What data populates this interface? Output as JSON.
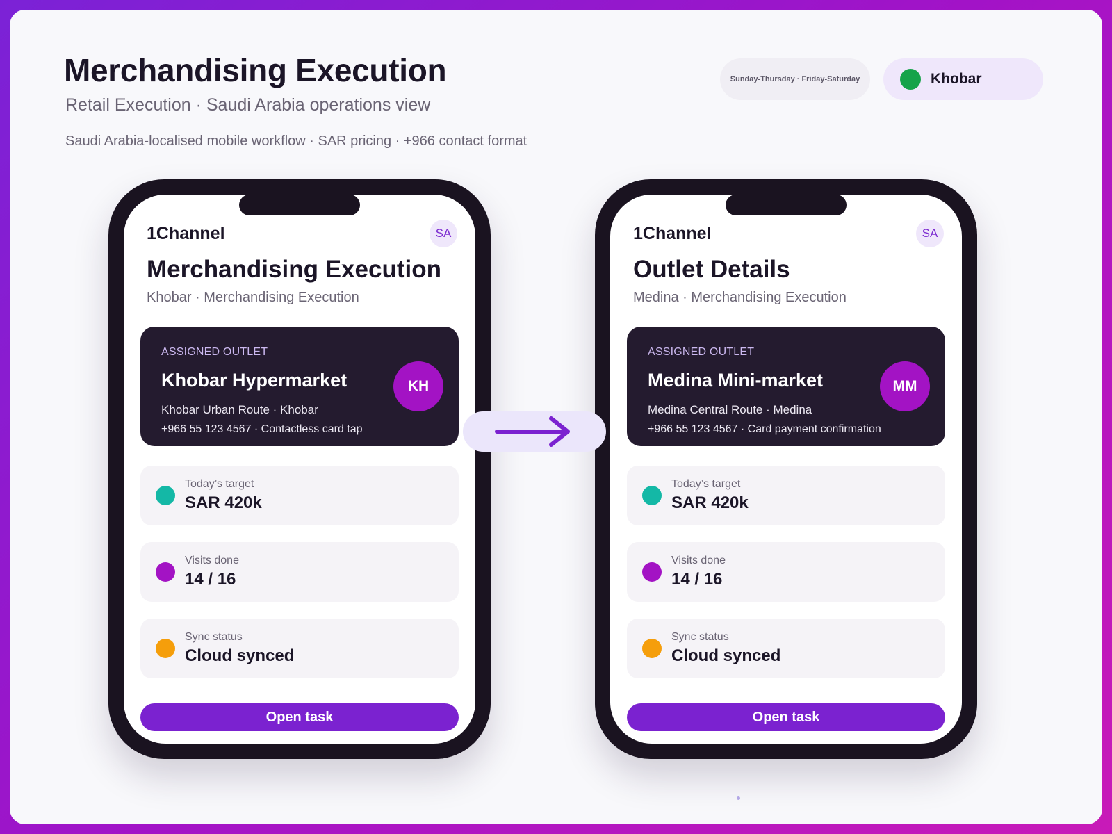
{
  "header": {
    "title": "Merchandising Execution",
    "subtitle": "Retail Execution · Saudi Arabia operations view",
    "meta": "Saudi Arabia-localised mobile workflow · SAR pricing · +966 contact format",
    "schedule": "Sunday-Thursday · Friday-Saturday",
    "city": "Khobar",
    "city_status_color": "#16a34a"
  },
  "colors": {
    "accent": "#7b22d0",
    "card_dark": "#241b2f",
    "avatar": "#a313c4",
    "target_dot": "#14b8a6",
    "visits_dot": "#a313c4",
    "sync_dot": "#f59e0b"
  },
  "phones": [
    {
      "brand": "1Channel",
      "lang": "SA",
      "title": "Merchandising Execution",
      "subtitle": "Khobar · Merchandising Execution",
      "outlet": {
        "kicker": "ASSIGNED OUTLET",
        "name": "Khobar Hypermarket",
        "route": "Khobar Urban Route · Khobar",
        "contact": "+966 55 123 4567 · Contactless card tap",
        "initials": "KH"
      },
      "stats": [
        {
          "label": "Today’s target",
          "value": "SAR 420k"
        },
        {
          "label": "Visits done",
          "value": "14 / 16"
        },
        {
          "label": "Sync status",
          "value": "Cloud synced"
        }
      ],
      "button": "Open task"
    },
    {
      "brand": "1Channel",
      "lang": "SA",
      "title": "Outlet Details",
      "subtitle": "Medina · Merchandising Execution",
      "outlet": {
        "kicker": "ASSIGNED OUTLET",
        "name": "Medina Mini-market",
        "route": "Medina Central Route · Medina",
        "contact": "+966 55 123 4567 · Card payment confirmation",
        "initials": "MM"
      },
      "stats": [
        {
          "label": "Today’s target",
          "value": "SAR 420k"
        },
        {
          "label": "Visits done",
          "value": "14 / 16"
        },
        {
          "label": "Sync status",
          "value": "Cloud synced"
        }
      ],
      "button": "Open task"
    }
  ],
  "icons": {
    "flow_arrow": "arrow-right-icon",
    "status_dot": "status-dot-icon"
  }
}
